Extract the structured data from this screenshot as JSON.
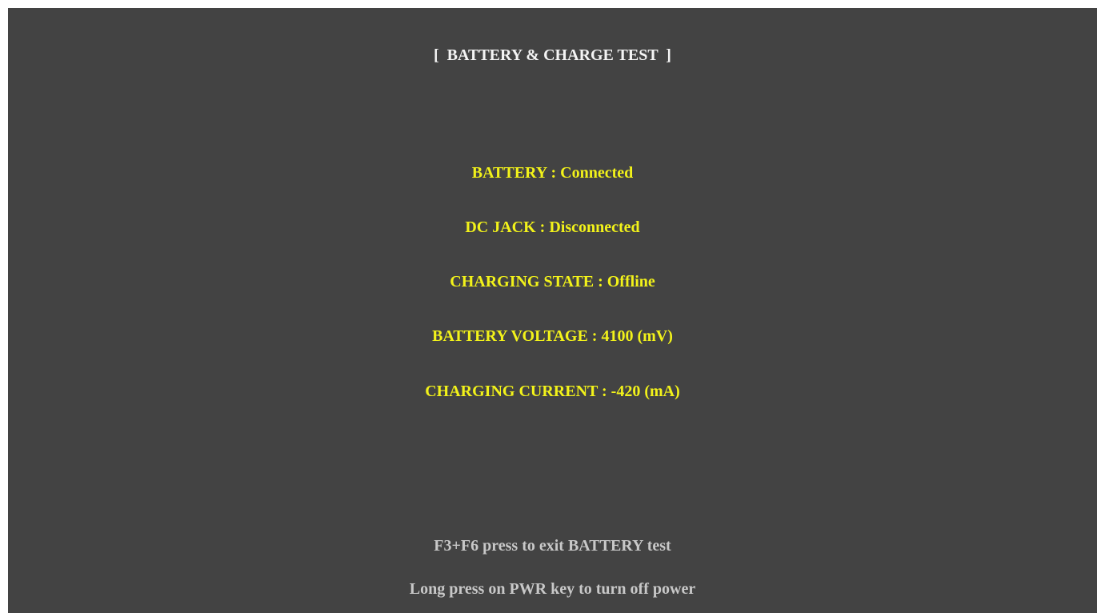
{
  "screen": {
    "title": "[  BATTERY & CHARGE TEST  ]",
    "status_lines": [
      "BATTERY : Connected",
      "DC JACK : Disconnected",
      "CHARGING STATE : Offline",
      "BATTERY VOLTAGE : 4100 (mV)",
      "CHARGING CURRENT : -420 (mA)"
    ],
    "hints": [
      "F3+F6 press to exit BATTERY test",
      "Long press on PWR key to turn off power"
    ]
  },
  "colors": {
    "background": "#434343",
    "title": "#f4f4f4",
    "status_text": "#f2f21a",
    "hint_text": "#c8c8c8"
  }
}
